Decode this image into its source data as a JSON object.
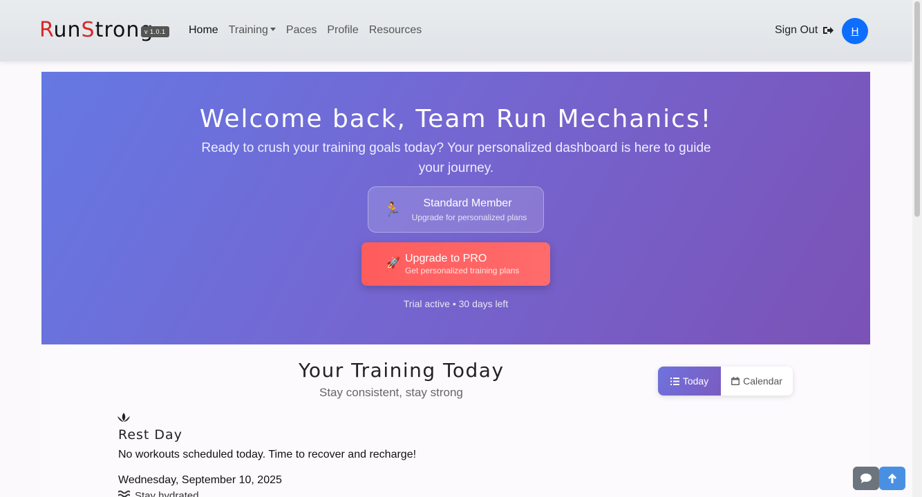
{
  "nav": {
    "brand_r": "R",
    "brand_un": "un",
    "brand_s": "S",
    "brand_trong": "trong",
    "version": "v 1.0.1",
    "links": [
      "Home",
      "Training",
      "Paces",
      "Profile",
      "Resources"
    ],
    "signout": "Sign Out",
    "avatar": "H"
  },
  "hero": {
    "title": "Welcome back, Team Run Mechanics!",
    "subtitle": "Ready to crush your training goals today? Your personalized dashboard is here to guide your journey.",
    "member_title": "Standard Member",
    "member_sub": "Upgrade for personalized plans",
    "upgrade_title": "Upgrade to PRO",
    "upgrade_sub": "Get personalized training plans",
    "trial": "Trial active • 30 days left"
  },
  "training": {
    "title": "Your Training Today",
    "subtitle": "Stay consistent, stay strong",
    "toggle_today": "Today",
    "toggle_calendar": "Calendar",
    "rest_title": "Rest Day",
    "rest_message": "No workouts scheduled today. Time to recover and recharge!",
    "date": "Wednesday, September 10, 2025",
    "tip": "Stay hydrated"
  },
  "icons": {
    "runner": "runner-icon",
    "rocket": "rocket-icon",
    "signout": "sign-out-icon",
    "list": "list-icon",
    "calendar": "calendar-icon",
    "lotus": "lotus-icon",
    "chat": "chat-icon",
    "arrow_up": "arrow-up-icon"
  },
  "colors": {
    "brand_red": "#d62828",
    "avatar_blue": "#0d6efd",
    "hero_start": "#6578e3",
    "hero_end": "#7b52b6",
    "upgrade_red": "#ff5c5c"
  }
}
